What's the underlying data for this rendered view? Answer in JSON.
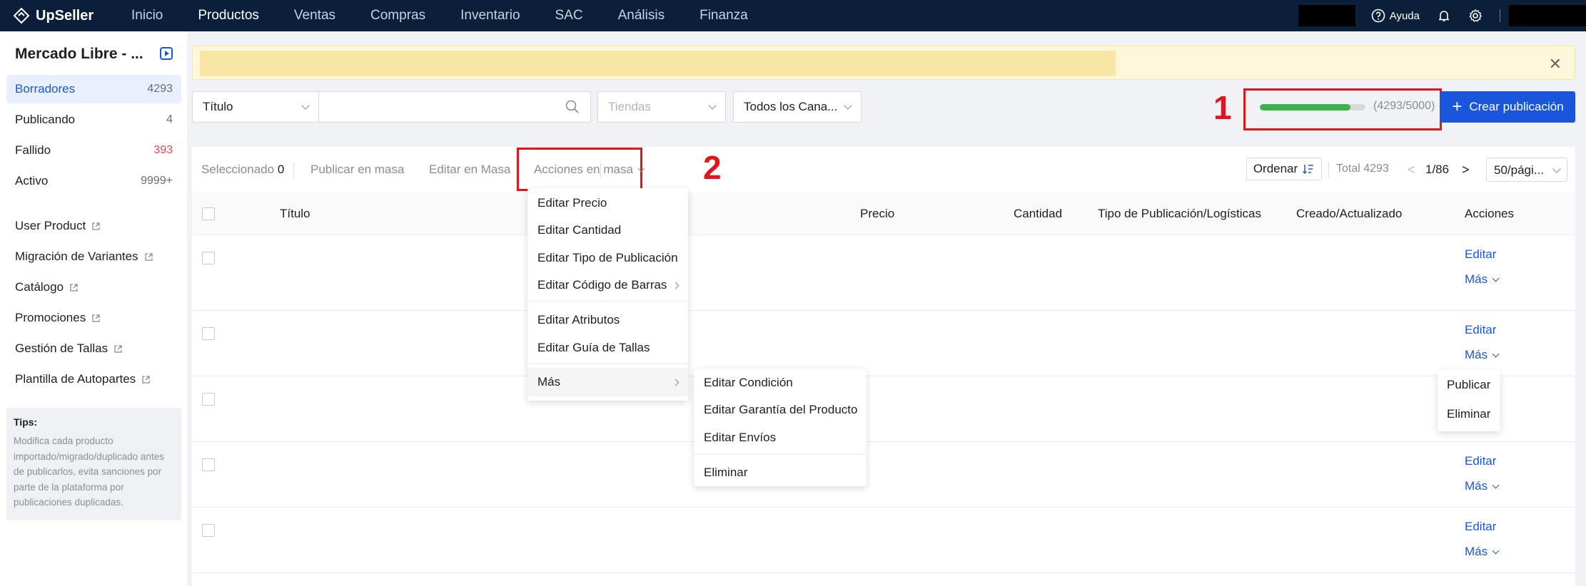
{
  "topbar": {
    "brand": "UpSeller",
    "nav": [
      "Inicio",
      "Productos",
      "Ventas",
      "Compras",
      "Inventario",
      "SAC",
      "Análisis",
      "Finanza"
    ],
    "active_nav": "Productos",
    "help": "Ayuda"
  },
  "sidebar": {
    "store": "Mercado Libre - ...",
    "statuses": [
      {
        "label": "Borradores",
        "count": "4293"
      },
      {
        "label": "Publicando",
        "count": "4"
      },
      {
        "label": "Fallido",
        "count": "393"
      },
      {
        "label": "Activo",
        "count": "9999+"
      }
    ],
    "links": [
      "User Product",
      "Migración de Variantes",
      "Catálogo",
      "Promociones",
      "Gestión de Tallas",
      "Plantilla de Autopartes"
    ],
    "tips_title": "Tips:",
    "tips_lines": [
      "Modifica cada producto",
      "importado/migrado/duplicado antes",
      "de publicarlos, evita sanciones por",
      "parte de la plataforma por",
      "publicaciones duplicadas."
    ]
  },
  "filters": {
    "field": "Título",
    "search_value": "",
    "store_placeholder": "Tiendas",
    "channel": "Todos los Cana..."
  },
  "quota": {
    "used": 4293,
    "total": 5000,
    "fraction": 0.8586,
    "label": "(4293/5000)",
    "marker": "1"
  },
  "create_button": "Crear publicación",
  "toolbar": {
    "selected_label": "Seleccionado",
    "selected_count": "0",
    "publish_bulk": "Publicar en masa",
    "edit_bulk": "Editar en Masa",
    "bulk_actions": "Acciones en masa",
    "marker": "2",
    "order": "Ordenar",
    "total": "Total 4293",
    "page": "1/86",
    "per_page": "50/pági..."
  },
  "table": {
    "columns": [
      "Título",
      "Precio",
      "Cantidad",
      "Tipo de Publicación/Logísticas",
      "Creado/Actualizado",
      "Acciones"
    ],
    "edit": "Editar",
    "more": "Más"
  },
  "bulk_menu": {
    "items": [
      "Editar Precio",
      "Editar Cantidad",
      "Editar Tipo de Publicación",
      "Editar Código de Barras",
      "Editar Atributos",
      "Editar Guía de Tallas",
      "Más"
    ]
  },
  "more_submenu": {
    "items": [
      "Editar Condición",
      "Editar Garantía del Producto",
      "Editar Envíos",
      "Eliminar"
    ]
  },
  "row_menu": {
    "items": [
      "Publicar",
      "Eliminar"
    ]
  },
  "colors": {
    "topbar": "#0b1f3a",
    "accent": "#1a56db",
    "marker": "#e3141b",
    "progress": "#3ab34a"
  }
}
